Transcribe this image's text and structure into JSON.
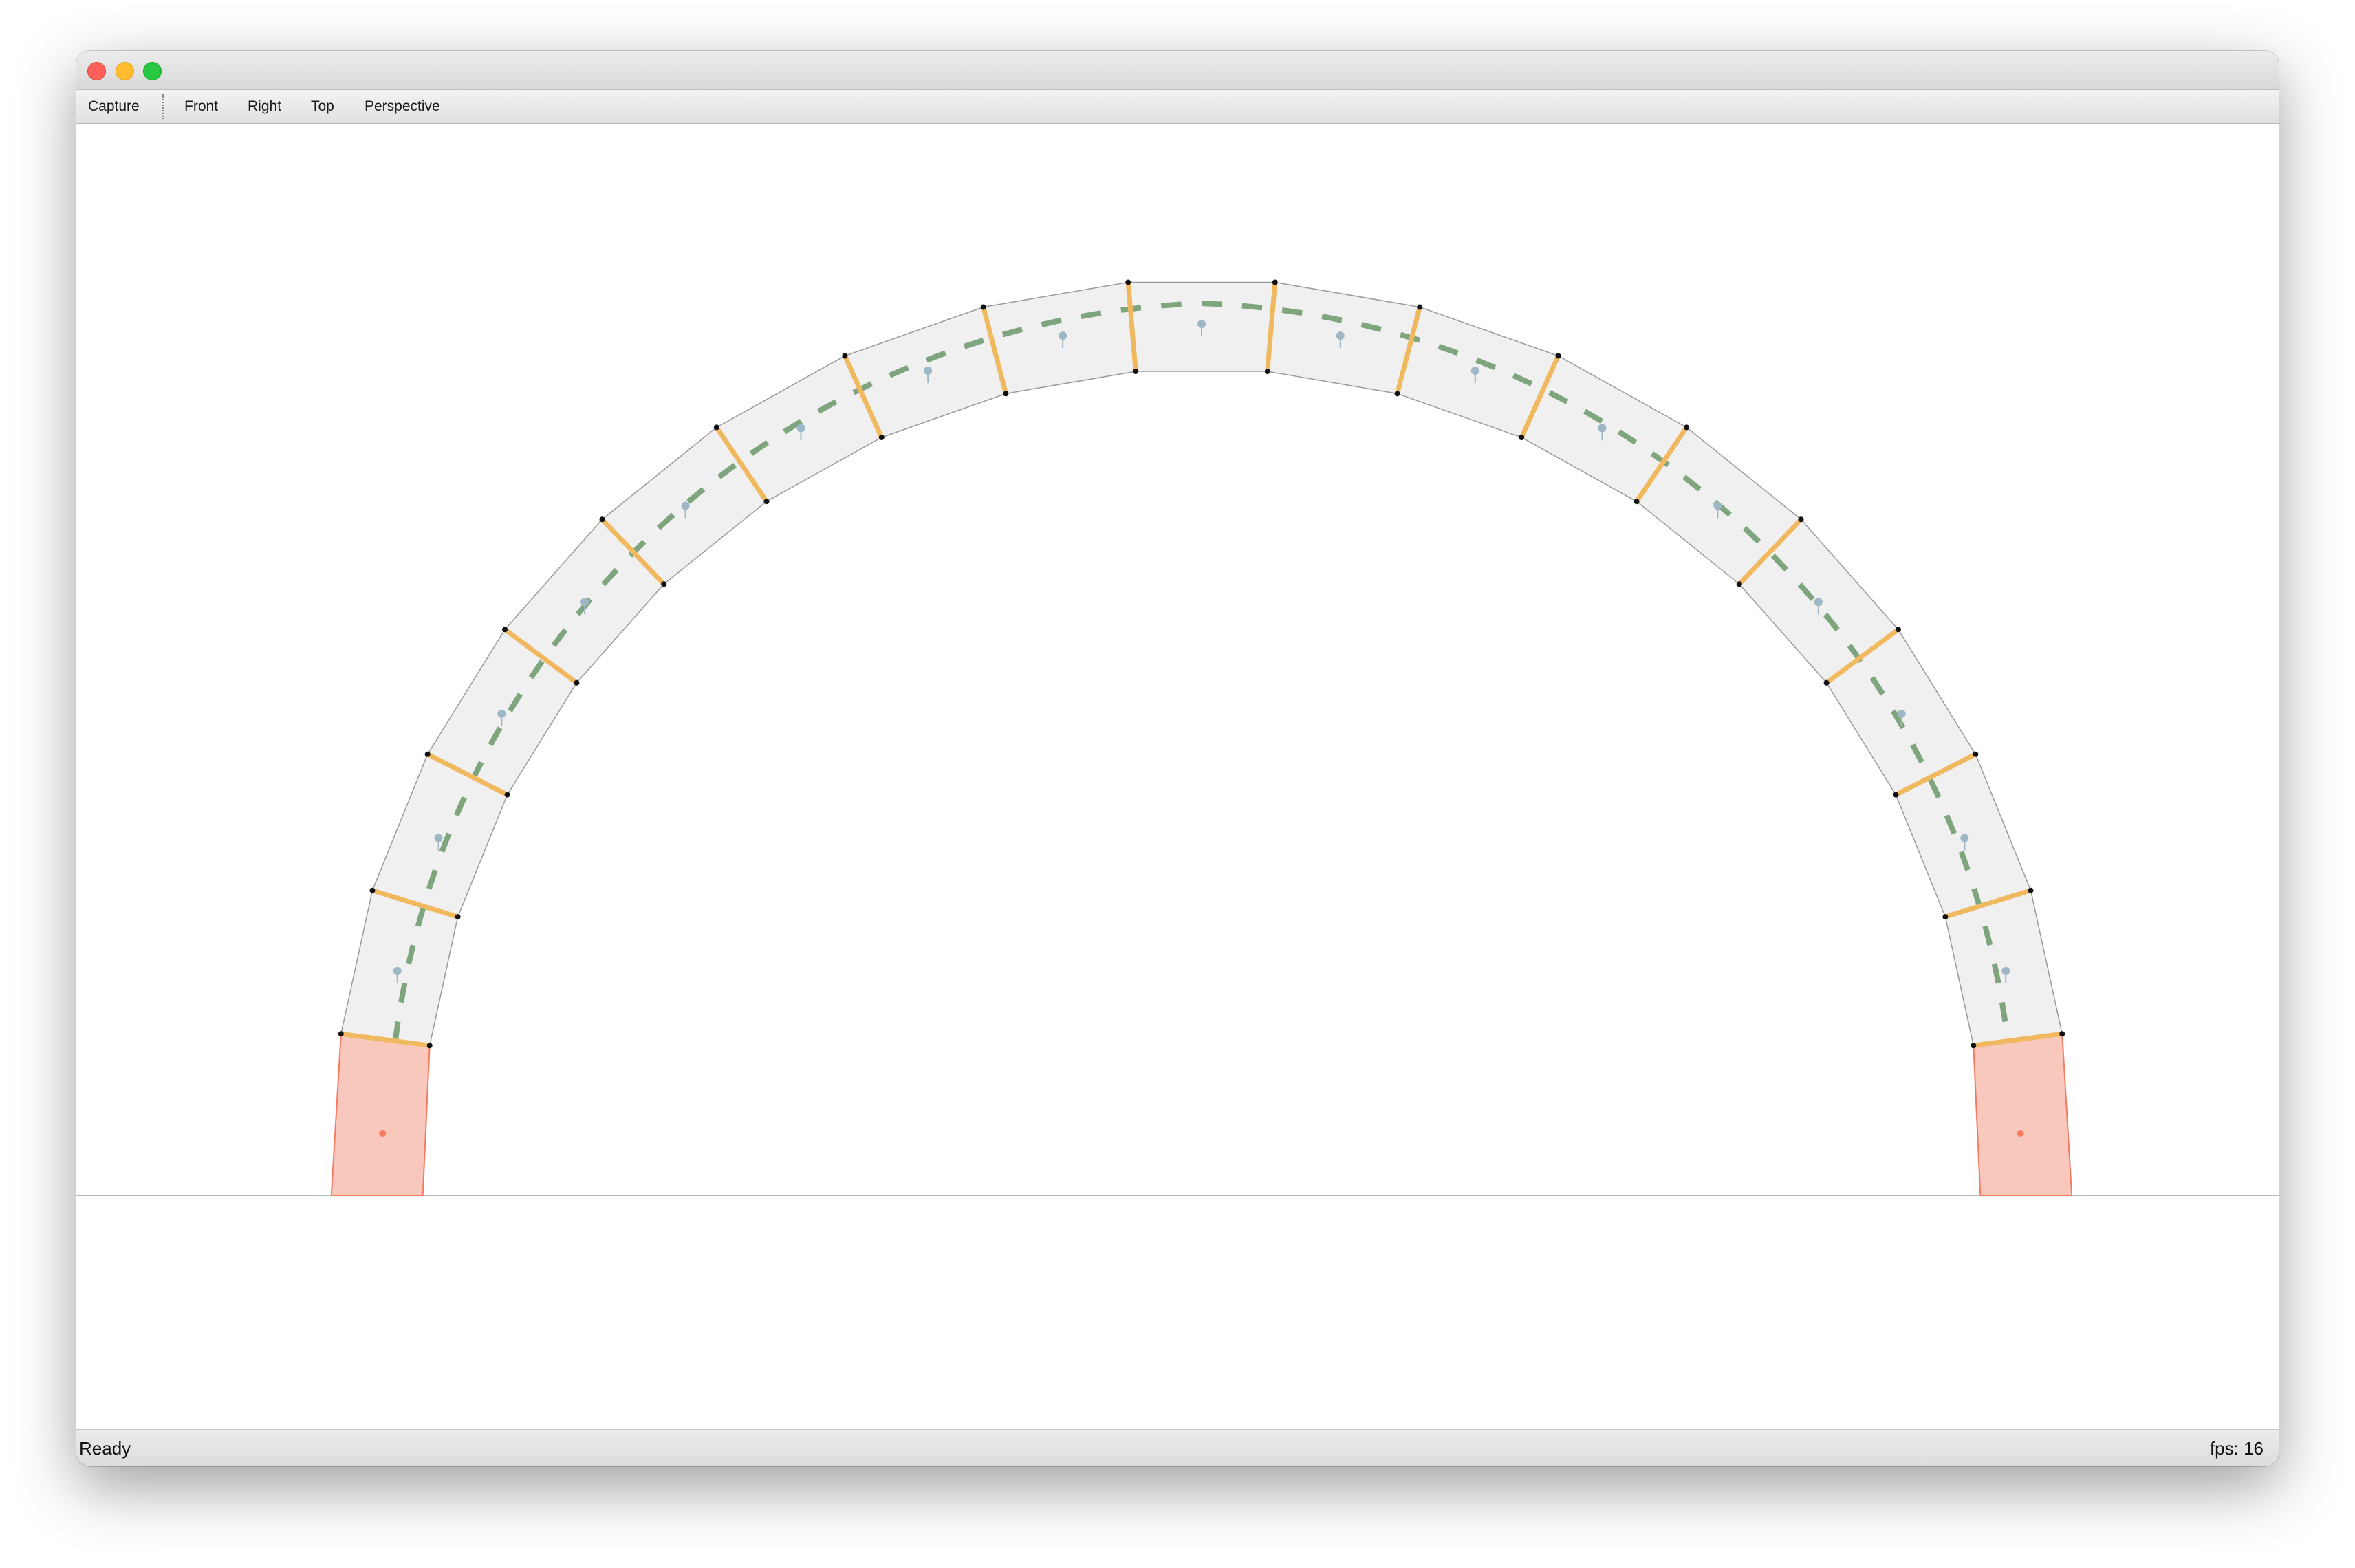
{
  "toolbar": {
    "capture": "Capture",
    "views": [
      "Front",
      "Right",
      "Top",
      "Perspective"
    ]
  },
  "status": {
    "message": "Ready",
    "fps": "fps: 16"
  },
  "scene": {
    "voussoir_count": 17,
    "colors": {
      "voussoir_fill": "#f0f0f0",
      "voussoir_stroke": "#9a9a9a",
      "interface": "#f0b960",
      "thrust_line": "#7ea57e",
      "support_fill": "#f9c8bc",
      "support_stroke": "#f47a62",
      "centroid": "#9db7c6",
      "ground": "#b8b8b8"
    }
  }
}
